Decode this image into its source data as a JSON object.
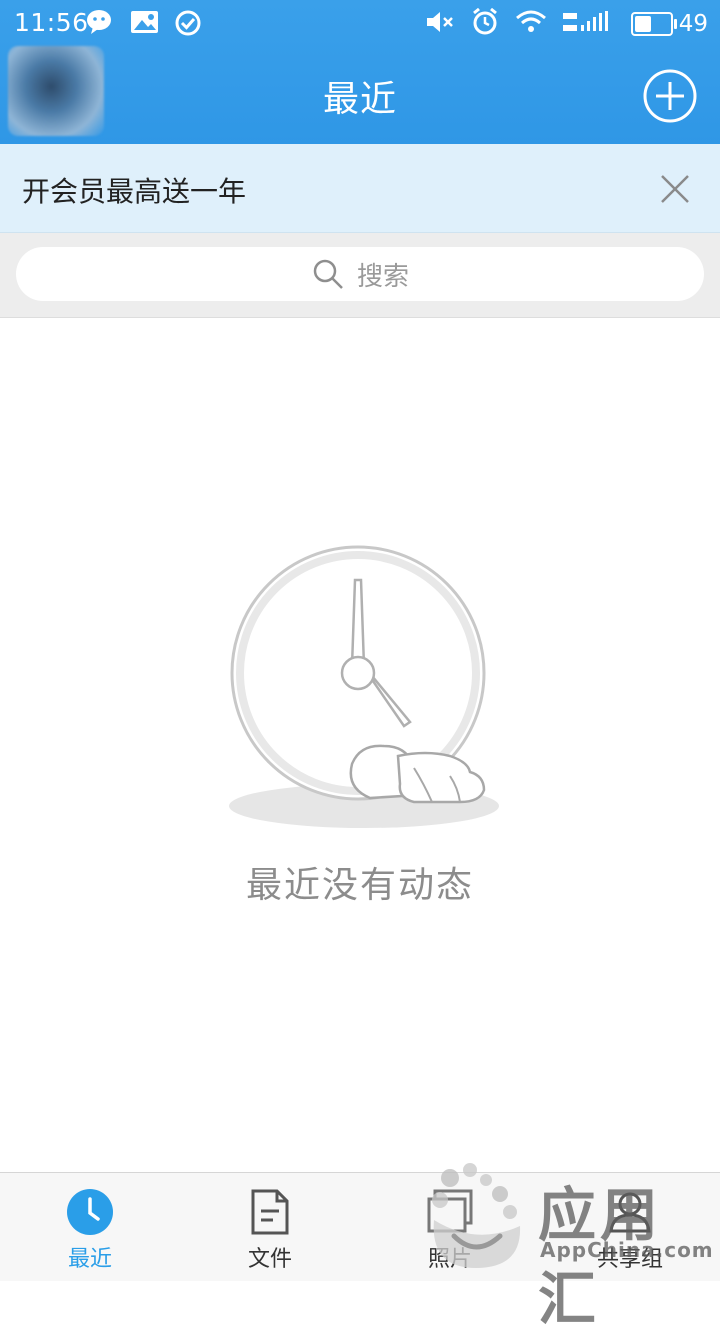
{
  "status_bar": {
    "time": "11:56",
    "battery_percent": "49",
    "battery_level": 0.49,
    "left_icons": [
      "wechat-icon",
      "gallery-notification-icon",
      "check-circle-icon"
    ],
    "right_icons": [
      "mute-icon",
      "alarm-icon",
      "wifi-icon",
      "signal-2g4g-icon",
      "battery-icon"
    ]
  },
  "header": {
    "title": "最近",
    "add_icon": "plus-circle-icon"
  },
  "promo": {
    "text": "开会员最高送一年",
    "close_icon": "close-icon"
  },
  "search": {
    "placeholder": "搜索",
    "icon": "search-icon"
  },
  "empty_state": {
    "illustration": "sleeping-clock-illustration",
    "message": "最近没有动态"
  },
  "tabs": [
    {
      "label": "最近",
      "icon": "clock-icon",
      "active": true
    },
    {
      "label": "文件",
      "icon": "document-icon",
      "active": false
    },
    {
      "label": "照片",
      "icon": "photo-icon",
      "active": false
    },
    {
      "label": "共享组",
      "icon": "group-icon",
      "active": false
    }
  ],
  "watermark": {
    "title": "应用汇",
    "subtitle": "AppChina.com"
  },
  "colors": {
    "header_blue": "#3aa0ea",
    "promo_bg": "#dff0fb",
    "tab_active": "#2a9ee8"
  }
}
